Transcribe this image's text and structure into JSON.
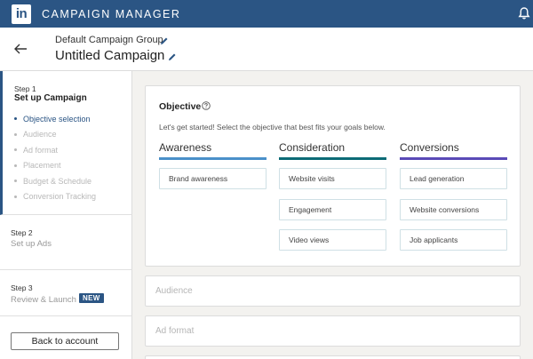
{
  "topbar": {
    "logo": "in",
    "title": "CAMPAIGN MANAGER",
    "icons": [
      "linkedin-logo",
      "bell-icon"
    ],
    "color": "#2b5584"
  },
  "header": {
    "group_name": "Default Campaign Group",
    "campaign_name": "Untitled Campaign",
    "icons": [
      "back-arrow-icon",
      "pencil-icon"
    ]
  },
  "sidebar": {
    "step1": {
      "label": "Step 1",
      "title": "Set up Campaign",
      "substeps": [
        {
          "label": "Objective selection",
          "active": true
        },
        {
          "label": "Audience",
          "active": false
        },
        {
          "label": "Ad format",
          "active": false
        },
        {
          "label": "Placement",
          "active": false
        },
        {
          "label": "Budget & Schedule",
          "active": false
        },
        {
          "label": "Conversion Tracking",
          "active": false
        }
      ]
    },
    "step2": {
      "label": "Step 2",
      "title": "Set up Ads"
    },
    "step3": {
      "label": "Step 3",
      "title": "Review & Launch",
      "badge": "NEW"
    },
    "back_button": "Back to account"
  },
  "objective": {
    "title": "Objective",
    "intro": "Let's get started! Select the objective that best fits your goals below.",
    "columns": [
      {
        "name": "Awareness",
        "color": "#4a90c9",
        "options": [
          "Brand awareness"
        ]
      },
      {
        "name": "Consideration",
        "color": "#0c6b76",
        "options": [
          "Website visits",
          "Engagement",
          "Video views"
        ]
      },
      {
        "name": "Conversions",
        "color": "#5a4ab7",
        "options": [
          "Lead generation",
          "Website conversions",
          "Job applicants"
        ]
      }
    ]
  },
  "sections": {
    "audience": "Audience",
    "ad_format": "Ad format"
  }
}
